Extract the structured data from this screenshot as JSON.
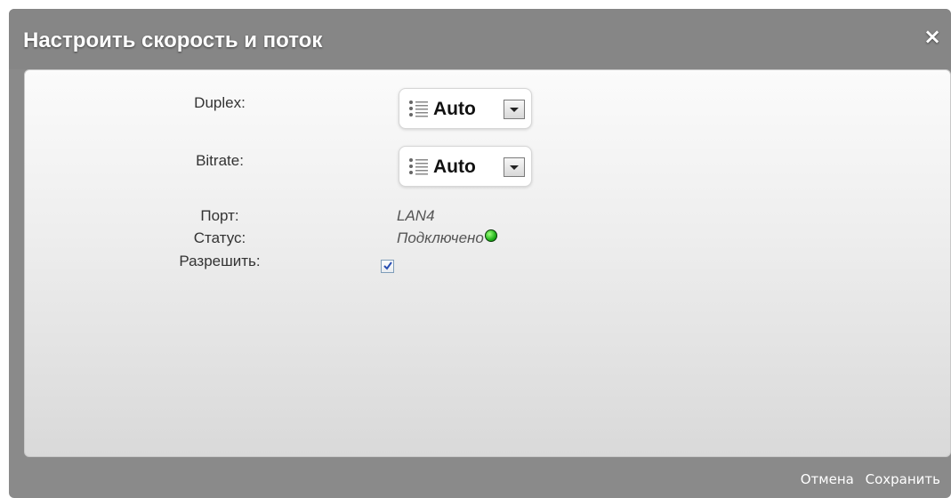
{
  "dialog": {
    "title": "Настроить скорость и поток",
    "close_symbol": "×"
  },
  "form": {
    "duplex_label": "Duplex:",
    "duplex_value": "Auto",
    "bitrate_label": "Bitrate:",
    "bitrate_value": "Auto",
    "port_label": "Порт:",
    "port_value": "LAN4",
    "status_label": "Статус:",
    "status_value": "Подключено",
    "status_color": "#21b21b",
    "enable_label": "Разрешить:",
    "enable_checked": true
  },
  "footer": {
    "cancel_label": "Отмена",
    "save_label": "Сохранить"
  },
  "icons": {
    "close": "close-icon",
    "list": "list-icon",
    "dropdown": "chevron-down-icon",
    "status": "status-dot-icon",
    "check": "checkmark-icon"
  },
  "colors": {
    "dialog_frame": "#8a8a8a",
    "content_background": "#ededed",
    "footer_text": "#ffffff"
  }
}
